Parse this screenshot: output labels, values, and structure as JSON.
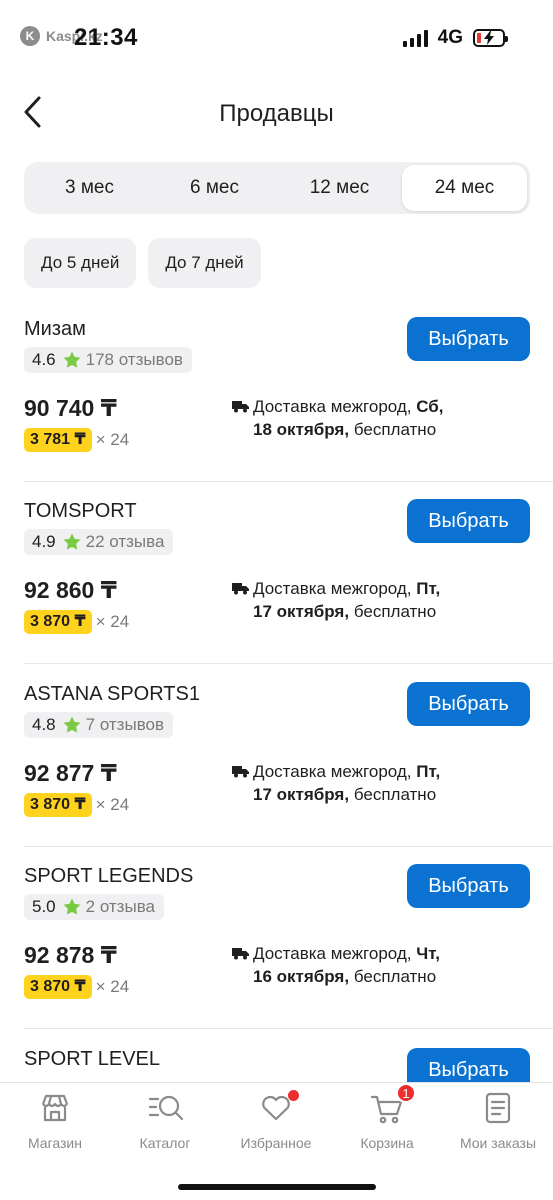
{
  "status_bar": {
    "app_logo": "K",
    "app_name": "Kaspi.kz",
    "time": "21:34",
    "network": "4G"
  },
  "header": {
    "title": "Продавцы",
    "back_icon": "chevron-left-icon"
  },
  "periods": [
    {
      "label": "3 мес",
      "active": false
    },
    {
      "label": "6 мес",
      "active": false
    },
    {
      "label": "12 мес",
      "active": false
    },
    {
      "label": "24 мес",
      "active": true
    }
  ],
  "delivery_filters": [
    {
      "label": "До 5 дней"
    },
    {
      "label": "До 7 дней"
    }
  ],
  "sellers": [
    {
      "name": "Мизам",
      "rating": "4.6",
      "reviews": "178 отзывов",
      "button": "Выбрать",
      "price": "90 740 ₸",
      "installment": "3 781 ₸",
      "installment_term": "× 24",
      "delivery_prefix": "Доставка межгород,",
      "delivery_day": "Сб,",
      "delivery_date": "18 октября,",
      "delivery_cost": "бесплатно"
    },
    {
      "name": "TOMSPORT",
      "rating": "4.9",
      "reviews": "22 отзыва",
      "button": "Выбрать",
      "price": "92 860 ₸",
      "installment": "3 870 ₸",
      "installment_term": "× 24",
      "delivery_prefix": "Доставка межгород,",
      "delivery_day": "Пт,",
      "delivery_date": "17 октября,",
      "delivery_cost": "бесплатно"
    },
    {
      "name": "ASTANA SPORTS1",
      "rating": "4.8",
      "reviews": "7 отзывов",
      "button": "Выбрать",
      "price": "92 877 ₸",
      "installment": "3 870 ₸",
      "installment_term": "× 24",
      "delivery_prefix": "Доставка межгород,",
      "delivery_day": "Пт,",
      "delivery_date": "17 октября,",
      "delivery_cost": "бесплатно"
    },
    {
      "name": "SPORT LEGENDS",
      "rating": "5.0",
      "reviews": "2 отзыва",
      "button": "Выбрать",
      "price": "92 878 ₸",
      "installment": "3 870 ₸",
      "installment_term": "× 24",
      "delivery_prefix": "Доставка межгород,",
      "delivery_day": "Чт,",
      "delivery_date": "16 октября,",
      "delivery_cost": "бесплатно"
    },
    {
      "name": "SPORT LEVEL",
      "rating": "",
      "reviews": "",
      "button": "Выбрать",
      "price": "",
      "installment": "",
      "installment_term": "",
      "delivery_prefix": "",
      "delivery_day": "",
      "delivery_date": "",
      "delivery_cost": ""
    }
  ],
  "tabbar": {
    "shop": {
      "label": "Магазин",
      "icon": "shop-icon"
    },
    "catalog": {
      "label": "Каталог",
      "icon": "catalog-search-icon"
    },
    "favorites": {
      "label": "Избранное",
      "icon": "heart-icon"
    },
    "cart": {
      "label": "Корзина",
      "icon": "cart-icon",
      "badge": "1"
    },
    "orders": {
      "label": "Мои заказы",
      "icon": "orders-icon"
    }
  },
  "colors": {
    "accent": "#0b72d2",
    "installment_badge": "#ffd21e",
    "star": "#7ac943",
    "notification": "#ee2d2d"
  }
}
